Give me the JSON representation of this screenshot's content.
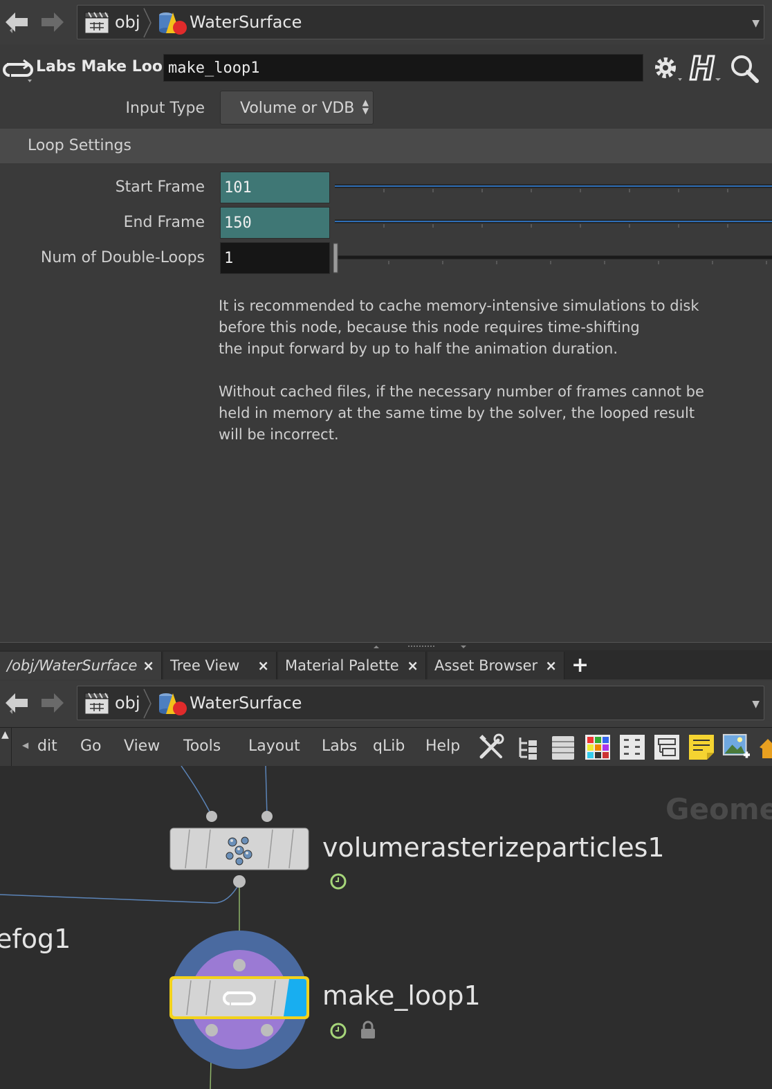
{
  "top_path": {
    "items": [
      {
        "label": "obj",
        "icon": "clapboard-icon"
      },
      {
        "label": "WaterSurface",
        "icon": "geometry-object-icon"
      }
    ]
  },
  "node": {
    "type_label": "Labs Make Loop",
    "name": "make_loop1"
  },
  "params": {
    "input_type_label": "Input Type",
    "input_type_value": "Volume or VDB",
    "folder_label": "Loop Settings",
    "start_frame_label": "Start Frame",
    "start_frame_value": "101",
    "end_frame_label": "End Frame",
    "end_frame_value": "150",
    "double_loops_label": "Num of Double-Loops",
    "double_loops_value": "1",
    "note_lines": [
      "It is recommended to cache memory-intensive simulations to disk",
      "before this node, because this node requires time-shifting",
      "the input forward by up to half the animation duration.",
      "",
      "Without cached files, if the necessary number of frames cannot be",
      "held in memory at the same time by the solver, the looped result",
      "will be incorrect."
    ]
  },
  "tabs": [
    {
      "label": "/obj/WaterSurface",
      "close": "×"
    },
    {
      "label": "Tree View",
      "close": "×"
    },
    {
      "label": "Material Palette",
      "close": "×"
    },
    {
      "label": "Asset Browser",
      "close": "×"
    }
  ],
  "add_tab": "+",
  "bottom_path": {
    "items": [
      {
        "label": "obj",
        "icon": "clapboard-icon"
      },
      {
        "label": "WaterSurface",
        "icon": "geometry-object-icon"
      }
    ]
  },
  "menubar": {
    "items": [
      "dit",
      "Go",
      "View",
      "Tools",
      "Layout",
      "Labs",
      "qLib",
      "Help"
    ],
    "tool_icons": [
      "wrench-screwdriver-icon",
      "tree-list-icon",
      "list-view-icon",
      "color-palette-icon",
      "grid-layout-icon",
      "network-layout-icon",
      "sticky-note-icon",
      "background-image-icon",
      "home-icon"
    ]
  },
  "network": {
    "context_label": "Geometry",
    "nodes": [
      {
        "name": "volumerasterizeparticles1",
        "icon": "particles-icon"
      },
      {
        "name": "make_loop1",
        "icon": "loop-icon"
      }
    ],
    "partial_label": "efog1"
  },
  "colors": {
    "teal_field": "#3f7775",
    "selection_yellow": "#f2d21b",
    "display_flag_blue": "#18aef0",
    "loop_halo_blue": "#4a6aa0",
    "loop_halo_purple": "#9b7ad4"
  }
}
